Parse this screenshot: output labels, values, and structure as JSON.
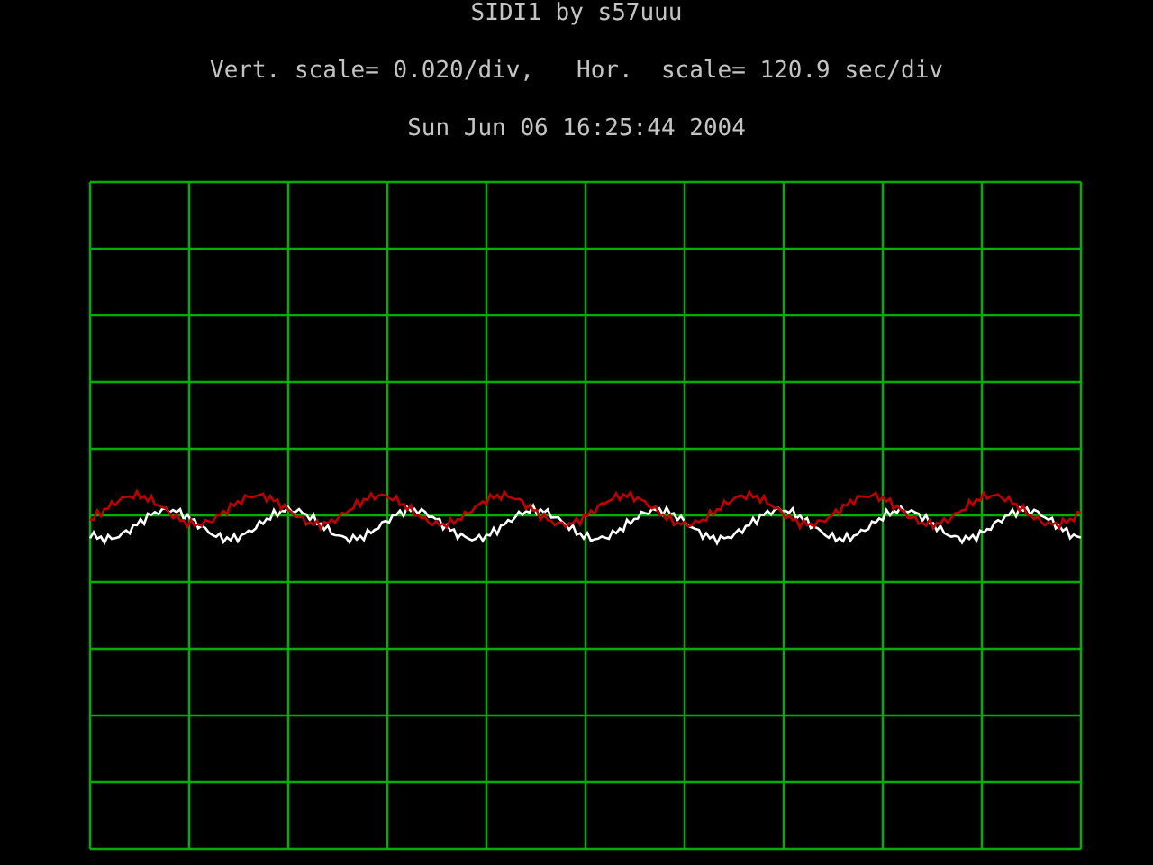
{
  "title": "SIDI1 by s57uuu",
  "scale_line": "Vert. scale= 0.020/div,   Hor.  scale= 120.9 sec/div",
  "timestamp": "Sun Jun 06 16:25:44 2004"
}
